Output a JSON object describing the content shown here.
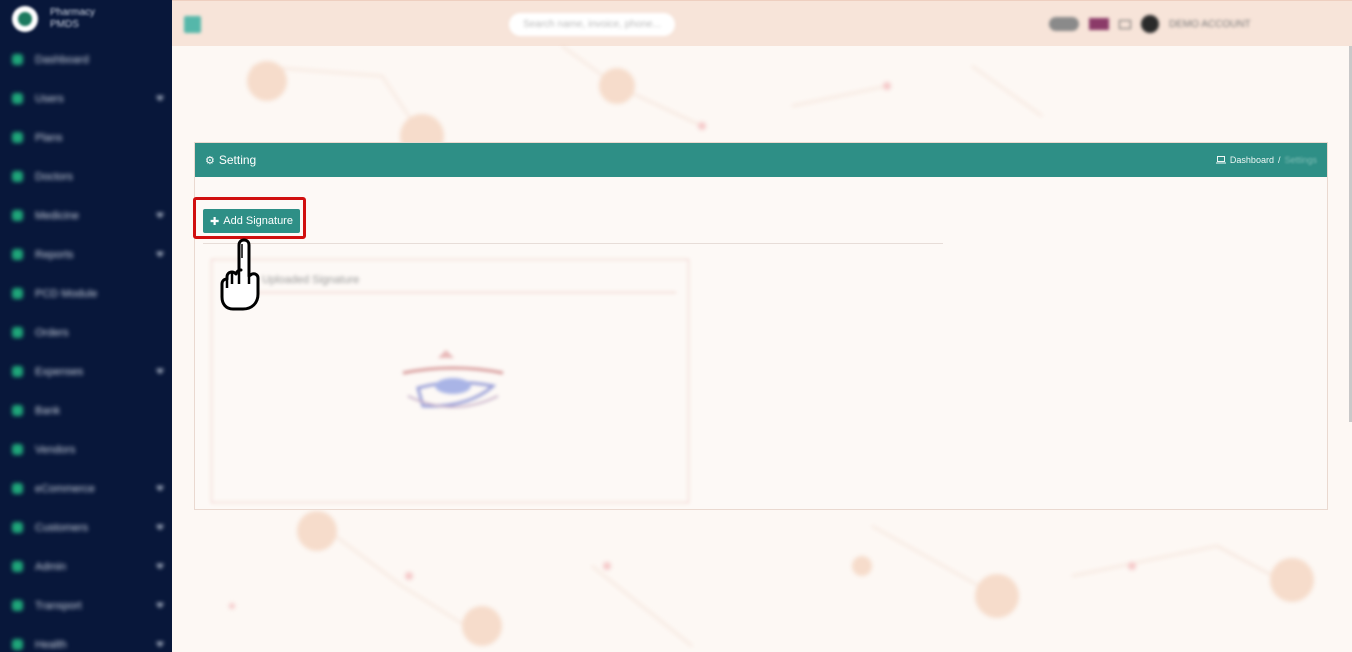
{
  "sidebar": {
    "brand_name_line1": "Pharmacy",
    "brand_name_line2": "PMDS",
    "items": [
      {
        "label": "Dashboard",
        "caret": false
      },
      {
        "label": "Users",
        "caret": true
      },
      {
        "label": "Plans",
        "caret": false
      },
      {
        "label": "Doctors",
        "caret": false
      },
      {
        "label": "Medicine",
        "caret": true
      },
      {
        "label": "Reports",
        "caret": true
      },
      {
        "label": "PCD Module",
        "caret": false
      },
      {
        "label": "Orders",
        "caret": false
      },
      {
        "label": "Expenses",
        "caret": true
      },
      {
        "label": "Bank",
        "caret": false
      },
      {
        "label": "Vendors",
        "caret": false
      },
      {
        "label": "eCommerce",
        "caret": true
      },
      {
        "label": "Customers",
        "caret": true
      },
      {
        "label": "Admin",
        "caret": true
      },
      {
        "label": "Transport",
        "caret": true
      },
      {
        "label": "Health",
        "caret": true
      }
    ]
  },
  "topbar": {
    "search_placeholder": "Search name, invoice, phone...",
    "account_label": "DEMO ACCOUNT"
  },
  "panel": {
    "title": "Setting",
    "breadcrumb_home": "Dashboard",
    "breadcrumb_sep": "/",
    "breadcrumb_current": "Settings",
    "add_button_label": "Add Signature",
    "card_title": "Uploaded Signature"
  },
  "colors": {
    "sidebar_bg": "#08173a",
    "accent_teal": "#2e8f86",
    "highlight_red": "#d10f0f",
    "topbar_bg": "#f7e4d9"
  },
  "icons": {
    "panel_title": "gear-icon",
    "breadcrumb": "laptop-icon",
    "add_button": "plus-icon",
    "overlay": "hand-pointer-icon"
  }
}
